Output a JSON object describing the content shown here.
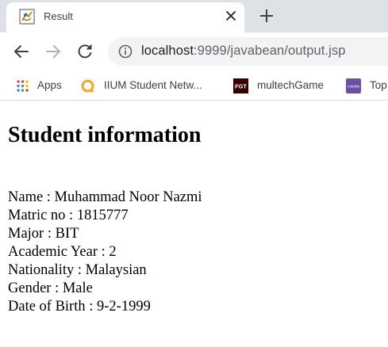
{
  "tab": {
    "title": "Result",
    "favicon": "java-applet-icon"
  },
  "toolbar": {
    "back": "back-arrow-icon",
    "forward": "forward-arrow-icon",
    "reload": "reload-icon",
    "url_host": "localhost",
    "url_path": ":9999/javabean/output.jsp"
  },
  "bookmarks": [
    {
      "label": "Apps",
      "icon": "apps-grid-icon"
    },
    {
      "label": "IIUM Student Netw...",
      "icon": "iium-logo-icon"
    },
    {
      "label": "multechGame",
      "icon": "fgt-logo-icon",
      "icon_text": "FGT"
    },
    {
      "label": "Top",
      "icon": "colorlib-logo-icon",
      "icon_text": "colorlib"
    }
  ],
  "page": {
    "title": "Student information",
    "rows": [
      "Name : Muhammad Noor Nazmi",
      "Matric no : 1815777",
      "Major : BIT",
      "Academic Year : 2",
      "Nationality : Malaysian",
      "Gender : Male",
      "Date of Birth : 9-2-1999"
    ]
  },
  "colors": {
    "tabstrip": "#dee1e6",
    "omnibox": "#f1f3f4",
    "iium_orange": "#f5a623",
    "fgt_dark": "#3a0000",
    "colorlib_purple": "#6b4fa0"
  }
}
